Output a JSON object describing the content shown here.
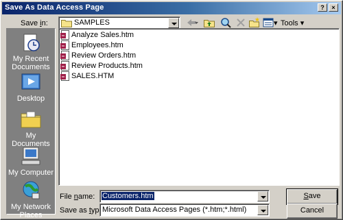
{
  "window": {
    "title": "Save As Data Access Page",
    "help_glyph": "?",
    "close_glyph": "×"
  },
  "save_in": {
    "label_pre": "Save ",
    "label_key": "i",
    "label_post": "n:",
    "value": "SAMPLES"
  },
  "toolbar": {
    "tools_label": "Tools",
    "tools_arrow": "▾",
    "views_arrow": "▾"
  },
  "places": [
    {
      "id": "recent",
      "label1": "My Recent",
      "label2": "Documents"
    },
    {
      "id": "desktop",
      "label1": "Desktop",
      "label2": ""
    },
    {
      "id": "mydocs",
      "label1": "My Documents",
      "label2": ""
    },
    {
      "id": "computer",
      "label1": "My Computer",
      "label2": ""
    },
    {
      "id": "network",
      "label1": "My Network",
      "label2": "Places"
    }
  ],
  "files": [
    {
      "name": "Analyze Sales.htm"
    },
    {
      "name": "Employees.htm"
    },
    {
      "name": "Review Orders.htm"
    },
    {
      "name": "Review Products.htm"
    },
    {
      "name": "SALES.HTM"
    }
  ],
  "file_name": {
    "label_pre": "File ",
    "label_key": "n",
    "label_post": "ame:",
    "value": "Customers.htm"
  },
  "save_as_type": {
    "label_pre": "Save as ",
    "label_key": "t",
    "label_post": "ype:",
    "value": "Microsoft Data Access Pages (*.htm;*.html)"
  },
  "buttons": {
    "save_key": "S",
    "save_rest": "ave",
    "cancel": "Cancel"
  },
  "colors": {
    "title_start": "#0a246a",
    "title_end": "#a6caf0",
    "selection": "#0a246a",
    "face": "#d4d0c8"
  }
}
